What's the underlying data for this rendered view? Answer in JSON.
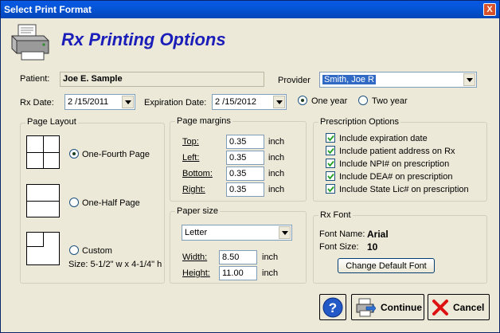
{
  "window": {
    "title": "Select Print Format",
    "close_label": "X"
  },
  "header": {
    "title": "Rx Printing Options"
  },
  "patient": {
    "label": "Patient:",
    "value": "Joe E. Sample"
  },
  "provider": {
    "label": "Provider",
    "value": "Smith, Joe R"
  },
  "rx_date": {
    "label": "Rx Date:",
    "value": "2 /15/2011"
  },
  "expiration": {
    "label": "Expiration Date:",
    "value": "2 /15/2012",
    "option_one_year": "One year",
    "option_two_year": "Two year",
    "selected": "One year"
  },
  "page_layout": {
    "title": "Page Layout",
    "options": [
      "One-Fourth Page",
      "One-Half Page",
      "Custom"
    ],
    "selected": "One-Fourth Page",
    "custom_size": "Size: 5-1/2\" w x 4-1/4\" h"
  },
  "page_margins": {
    "title": "Page margins",
    "top_label": "Top:",
    "top_value": "0.35",
    "left_label": "Left:",
    "left_value": "0.35",
    "bottom_label": "Bottom:",
    "bottom_value": "0.35",
    "right_label": "Right:",
    "right_value": "0.35",
    "unit": "inch"
  },
  "paper_size": {
    "title": "Paper size",
    "selected": "Letter",
    "width_label": "Width:",
    "width_value": "8.50",
    "height_label": "Height:",
    "height_value": "11.00",
    "unit": "inch"
  },
  "prescription_options": {
    "title": "Prescription Options",
    "items": [
      {
        "label": "Include expiration date",
        "checked": true
      },
      {
        "label": "Include patient address on Rx",
        "checked": true
      },
      {
        "label": "Include NPI# on prescription",
        "checked": true
      },
      {
        "label": "Include DEA# on prescription",
        "checked": true
      },
      {
        "label": "Include State Lic# on prescription",
        "checked": true
      }
    ]
  },
  "rx_font": {
    "title": "Rx Font",
    "name_label": "Font Name:",
    "name_value": "Arial",
    "size_label": "Font Size:",
    "size_value": "10",
    "change_button": "Change Default Font"
  },
  "buttons": {
    "help": "?",
    "continue": "Continue",
    "cancel": "Cancel"
  },
  "colors": {
    "title_bar": "#0555d8",
    "header_text": "#1b1eb8",
    "selection": "#316ac5"
  }
}
